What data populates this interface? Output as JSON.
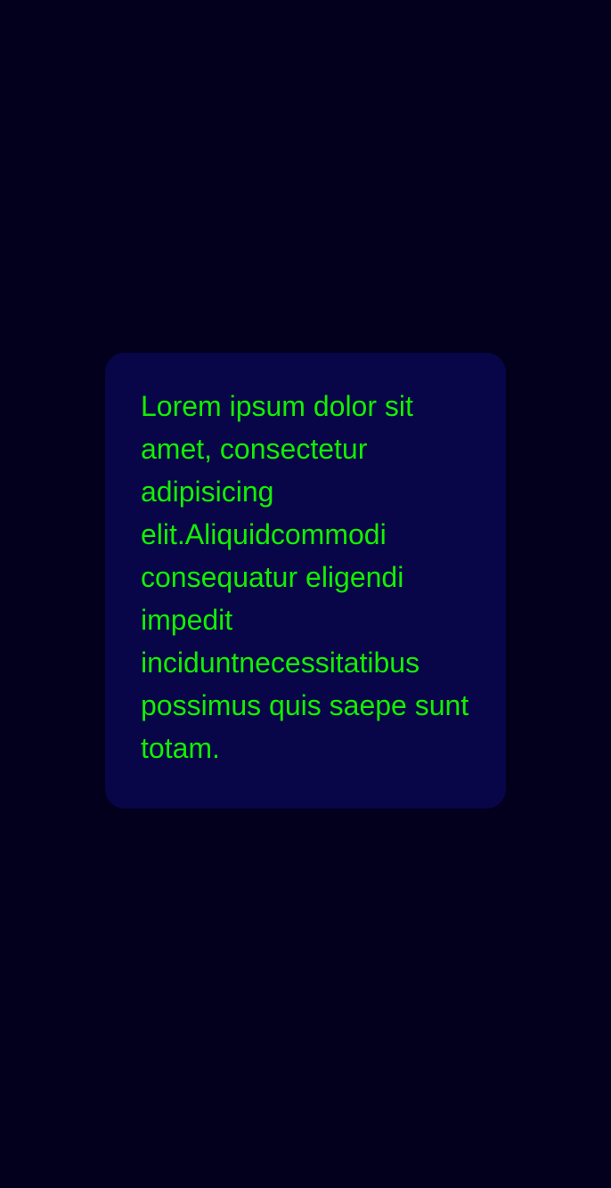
{
  "card": {
    "lines": [
      "Lorem ipsum dolor sit",
      "amet, consectetur",
      "adipisicing",
      "elit.Aliquidcommodi",
      "consequatur eligendi",
      "impedit",
      "inciduntnecessitatibus",
      "possimus quis saepe sunt",
      "totam."
    ]
  },
  "colors": {
    "background": "#02001c",
    "card": "#080548",
    "text": "#12f000"
  }
}
